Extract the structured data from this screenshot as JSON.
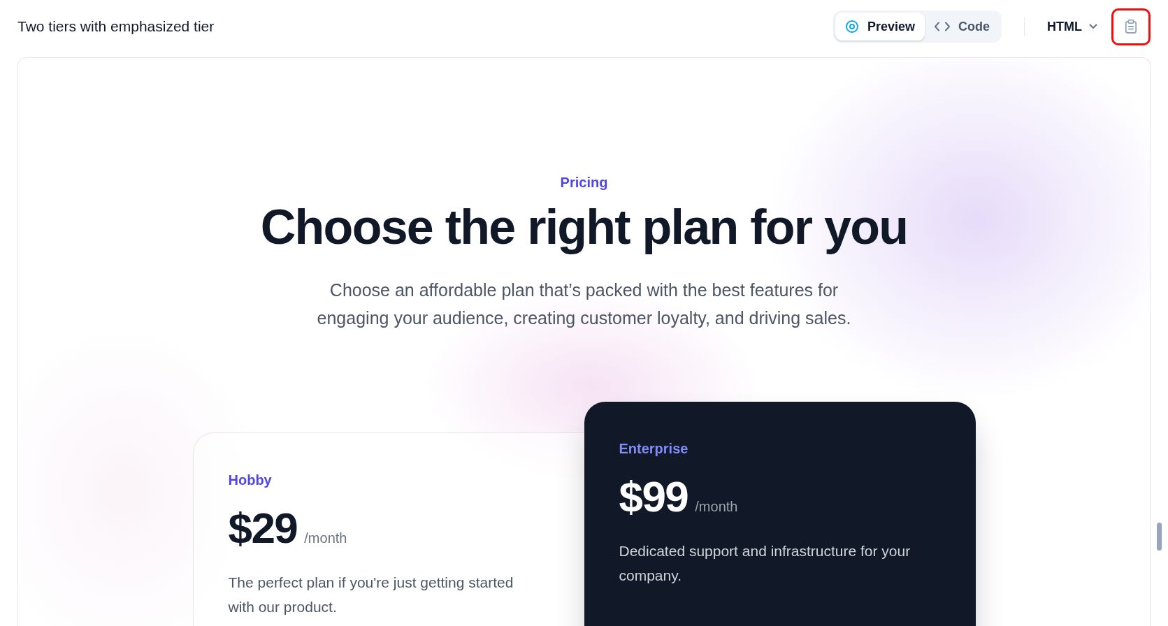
{
  "page_title": "Two tiers with emphasized tier",
  "view_tabs": [
    {
      "kind": "preview",
      "label": "Preview",
      "selected": true
    },
    {
      "kind": "code",
      "label": "Code",
      "selected": false
    }
  ],
  "language_select": {
    "value": "HTML"
  },
  "copy_button": {
    "highlighted": true
  },
  "pricing": {
    "eyebrow": "Pricing",
    "heading": "Choose the right plan for you",
    "subheading": "Choose an affordable plan that’s packed with the best features for engaging your audience, creating customer loyalty, and driving sales.",
    "tiers": [
      {
        "name": "Hobby",
        "price": "$29",
        "period": "/month",
        "description": "The perfect plan if you're just getting started with our product.",
        "emphasized": false
      },
      {
        "name": "Enterprise",
        "price": "$99",
        "period": "/month",
        "description": "Dedicated support and infrastructure for your company.",
        "emphasized": true
      }
    ]
  }
}
